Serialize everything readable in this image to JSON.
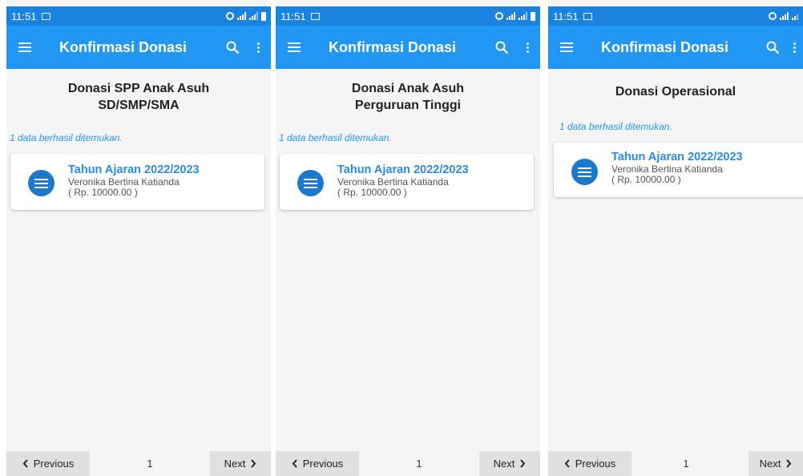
{
  "screens": [
    {
      "status": {
        "time": "11:51"
      },
      "appbar": {
        "title": "Konfirmasi Donasi"
      },
      "heading": [
        "Donasi SPP Anak Asuh",
        "SD/SMP/SMA"
      ],
      "found_text": "1 data berhasil ditemukan.",
      "card": {
        "title": "Tahun Ajaran 2022/2023",
        "name": "Veronika Bertina Katianda",
        "amount": "( Rp. 10000.00 )"
      },
      "pager": {
        "prev": "Previous",
        "page": "1",
        "next": "Next"
      }
    },
    {
      "status": {
        "time": "11:51"
      },
      "appbar": {
        "title": "Konfirmasi Donasi"
      },
      "heading": [
        "Donasi Anak Asuh",
        "Perguruan Tinggi"
      ],
      "found_text": "1 data berhasil ditemukan.",
      "card": {
        "title": "Tahun Ajaran 2022/2023",
        "name": "Veronika Bertina Katianda",
        "amount": "( Rp. 10000.00 )"
      },
      "pager": {
        "prev": "Previous",
        "page": "1",
        "next": "Next"
      }
    },
    {
      "status": {
        "time": "11:51"
      },
      "appbar": {
        "title": "Konfirmasi Donasi"
      },
      "heading": [
        "Donasi Operasional"
      ],
      "found_text": "1 data berhasil ditemukan.",
      "card": {
        "title": "Tahun Ajaran 2022/2023",
        "name": "Veronika Bertina Katianda",
        "amount": "( Rp. 10000.00 )"
      },
      "pager": {
        "prev": "Previous",
        "page": "1",
        "next": "Next"
      }
    }
  ],
  "icons": {
    "menu": "hamburger-icon",
    "search": "search-icon",
    "more": "more-vert-icon",
    "card": "list-icon",
    "prev": "chevron-left-icon",
    "next": "chevron-right-icon"
  },
  "colors": {
    "status_bar": "#1a83e0",
    "app_bar": "#2196f3",
    "accent": "#2a8be0",
    "card_icon": "#1a78cf",
    "background": "#f5f5f5"
  }
}
